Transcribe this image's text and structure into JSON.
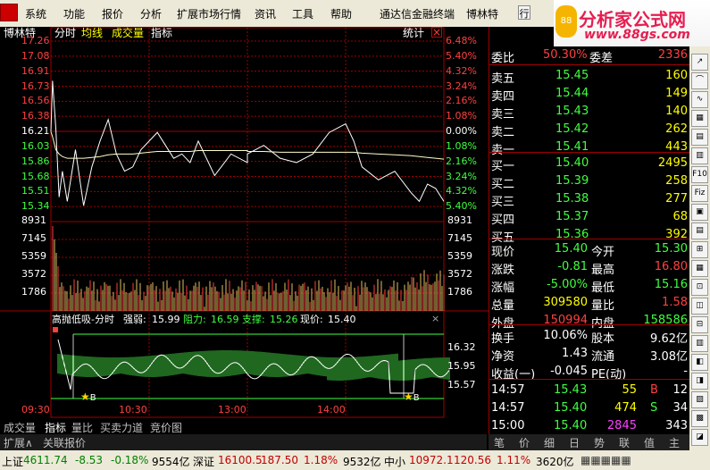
{
  "menu": {
    "items": [
      "系统",
      "功能",
      "报价",
      "分析",
      "扩展市场行情",
      "资讯",
      "工具",
      "帮助"
    ],
    "app_title": "通达信金融终端",
    "stock": "博林特",
    "right_cut": "行"
  },
  "brand": {
    "name": "分析家公式网",
    "url": "www.88gs.com",
    "badge": "88"
  },
  "chart": {
    "title": "博林特",
    "mode": [
      "分时",
      "均线",
      "成交量",
      "指标"
    ],
    "right_btn": "统计",
    "price_ticks": [
      "17.26",
      "17.08",
      "16.91",
      "16.73",
      "16.56",
      "16.38",
      "16.21",
      "16.03",
      "15.86",
      "15.68",
      "15.51",
      "15.34"
    ],
    "pct_ticks": [
      "6.48%",
      "5.40%",
      "4.32%",
      "3.24%",
      "2.16%",
      "1.08%",
      "0.00%",
      "1.08%",
      "2.16%",
      "3.24%",
      "4.32%",
      "5.40%"
    ],
    "vol_ticks": [
      "8931",
      "7145",
      "5359",
      "3572",
      "1786"
    ],
    "ind_header": {
      "name": "高抛低吸-分时",
      "strong_label": "强弱:",
      "strong": "15.99",
      "resist_label": "阻力:",
      "resist": "16.59",
      "support_label": "支撑:",
      "support": "15.26",
      "price_label": "现价:",
      "price": "15.40"
    },
    "ind_ticks": [
      "16.32",
      "15.95",
      "15.57"
    ],
    "time_ticks": [
      "09:30",
      "10:30",
      "13:00",
      "14:00"
    ],
    "marker": "B",
    "intraday_price_series": {
      "x": [
        "09:30",
        "09:31",
        "09:33",
        "09:35",
        "09:37",
        "09:40",
        "09:45",
        "09:50",
        "09:55",
        "10:00",
        "10:05",
        "10:10",
        "10:15",
        "10:20",
        "10:25",
        "10:30",
        "10:35",
        "10:40",
        "10:45",
        "10:50",
        "10:55",
        "11:00",
        "11:10",
        "11:20",
        "11:30",
        "13:00",
        "13:10",
        "13:20",
        "13:30",
        "13:40",
        "13:50",
        "14:00",
        "14:05",
        "14:10",
        "14:20",
        "14:30",
        "14:40",
        "14:45",
        "14:50",
        "14:55",
        "15:00"
      ],
      "y": [
        16.21,
        16.8,
        16.25,
        15.45,
        15.75,
        15.4,
        16.0,
        15.35,
        15.8,
        16.1,
        16.35,
        15.95,
        15.75,
        15.8,
        16.0,
        16.1,
        16.2,
        16.05,
        15.9,
        15.95,
        15.85,
        16.1,
        15.7,
        15.95,
        15.85,
        15.95,
        16.05,
        15.9,
        15.85,
        15.95,
        16.2,
        16.3,
        16.1,
        15.8,
        15.65,
        15.75,
        15.5,
        15.4,
        15.6,
        15.55,
        15.4
      ]
    },
    "avg_series": {
      "y": [
        16.21,
        16.15,
        16.0,
        15.95,
        15.92,
        15.9,
        15.9,
        15.9,
        15.91,
        15.92,
        15.94,
        15.95,
        15.95,
        15.95,
        15.96,
        15.97,
        15.98,
        15.98,
        15.98,
        15.98,
        15.98,
        15.99,
        15.99,
        15.99,
        15.99,
        15.98,
        15.98,
        15.97,
        15.97,
        15.97,
        15.97,
        15.97,
        15.97,
        15.96,
        15.95,
        15.94,
        15.93,
        15.92,
        15.91,
        15.9,
        15.89
      ]
    }
  },
  "tabs": [
    "成交量",
    "指标",
    "量比",
    "买卖力道",
    "竞价图"
  ],
  "tabs2": [
    "扩展∧",
    "关联报价"
  ],
  "side": {
    "wb_label": "委比",
    "wb_val": "50.30%",
    "wc_label": "委差",
    "wc_val": "2336",
    "sells": [
      {
        "label": "卖五",
        "price": "15.45",
        "vol": "160"
      },
      {
        "label": "卖四",
        "price": "15.44",
        "vol": "149"
      },
      {
        "label": "卖三",
        "price": "15.43",
        "vol": "140"
      },
      {
        "label": "卖二",
        "price": "15.42",
        "vol": "262"
      },
      {
        "label": "卖一",
        "price": "15.41",
        "vol": "443"
      }
    ],
    "buys": [
      {
        "label": "买一",
        "price": "15.40",
        "vol": "2495"
      },
      {
        "label": "买二",
        "price": "15.39",
        "vol": "258"
      },
      {
        "label": "买三",
        "price": "15.38",
        "vol": "277"
      },
      {
        "label": "买四",
        "price": "15.37",
        "vol": "68"
      },
      {
        "label": "买五",
        "price": "15.36",
        "vol": "392"
      }
    ],
    "quote": [
      {
        "l1": "现价",
        "v1": "15.40",
        "c1": "grn",
        "l2": "今开",
        "v2": "15.30",
        "c2": "grn"
      },
      {
        "l1": "涨跌",
        "v1": "-0.81",
        "c1": "grn",
        "l2": "最高",
        "v2": "16.80",
        "c2": "red"
      },
      {
        "l1": "涨幅",
        "v1": "-5.00%",
        "c1": "grn",
        "l2": "最低",
        "v2": "15.16",
        "c2": "grn"
      },
      {
        "l1": "总量",
        "v1": "309580",
        "c1": "yel",
        "l2": "量比",
        "v2": "1.58",
        "c2": "red"
      },
      {
        "l1": "外盘",
        "v1": "150994",
        "c1": "red",
        "l2": "内盘",
        "v2": "158586",
        "c2": "grn"
      }
    ],
    "fin": [
      {
        "l1": "换手",
        "v1": "10.06%",
        "l2": "股本",
        "v2": "9.62亿"
      },
      {
        "l1": "净资",
        "v1": "1.43",
        "l2": "流通",
        "v2": "3.08亿"
      },
      {
        "l1": "收益(一)",
        "v1": "-0.045",
        "l2": "PE(动)",
        "v2": "-"
      }
    ],
    "ticks": [
      {
        "t": "14:57",
        "p": "15.43",
        "v": "55",
        "f": "B",
        "fc": "red",
        "n": "12",
        "vc": "yel"
      },
      {
        "t": "14:57",
        "p": "15.40",
        "v": "474",
        "f": "S",
        "fc": "grn",
        "n": "34",
        "vc": "yel"
      },
      {
        "t": "15:00",
        "p": "15.40",
        "v": "2845",
        "f": "",
        "fc": "wht",
        "n": "343",
        "vc": "mag"
      }
    ],
    "tabs": [
      "笔",
      "价",
      "细",
      "日",
      "势",
      "联",
      "值",
      "主"
    ]
  },
  "icons": [
    "↗",
    "⌒",
    "∿",
    "▦",
    "▤",
    "▥",
    "F10",
    "Fiz",
    "▣",
    "▤",
    "⊞",
    "▦",
    "⊡",
    "◫",
    "⊟",
    "▥",
    "◧",
    "◨",
    "▨",
    "▩",
    "◪"
  ],
  "status": [
    {
      "t": "上证",
      "c": "#000"
    },
    {
      "t": "4611.74",
      "c": "#008000"
    },
    {
      "t": "-8.53",
      "c": "#008000"
    },
    {
      "t": "-0.18%",
      "c": "#008000"
    },
    {
      "t": "9554亿",
      "c": "#000"
    },
    {
      "t": "深证",
      "c": "#000"
    },
    {
      "t": "16100.5",
      "c": "#c00000"
    },
    {
      "t": "187.50",
      "c": "#c00000"
    },
    {
      "t": "1.18%",
      "c": "#c00000"
    },
    {
      "t": "9532亿",
      "c": "#000"
    },
    {
      "t": "中小",
      "c": "#000"
    },
    {
      "t": "10972.1",
      "c": "#c00000"
    },
    {
      "t": "120.56",
      "c": "#c00000"
    },
    {
      "t": "1.11%",
      "c": "#c00000"
    },
    {
      "t": "3620亿",
      "c": "#000"
    }
  ]
}
